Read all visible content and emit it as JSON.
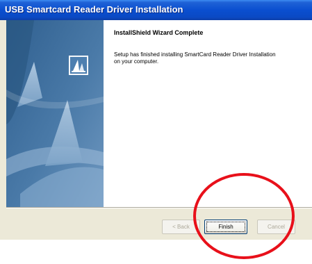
{
  "window": {
    "title": "USB Smartcard Reader Driver Installation"
  },
  "side_panel": {
    "logo_icon": "installshield-logo-icon"
  },
  "main": {
    "heading": "InstallShield Wizard Complete",
    "message": "Setup has finished installing SmartCard Reader Driver Installation on your computer."
  },
  "buttons": {
    "back_label": "< Back",
    "finish_label": "Finish",
    "cancel_label": "Cancel"
  },
  "annotation": {
    "shape": "circle",
    "color": "#e8101a"
  },
  "colors": {
    "titlebar": "#0a4fd0",
    "side_panel": "#3a6ea5",
    "dialog_face": "#ece9d8"
  }
}
